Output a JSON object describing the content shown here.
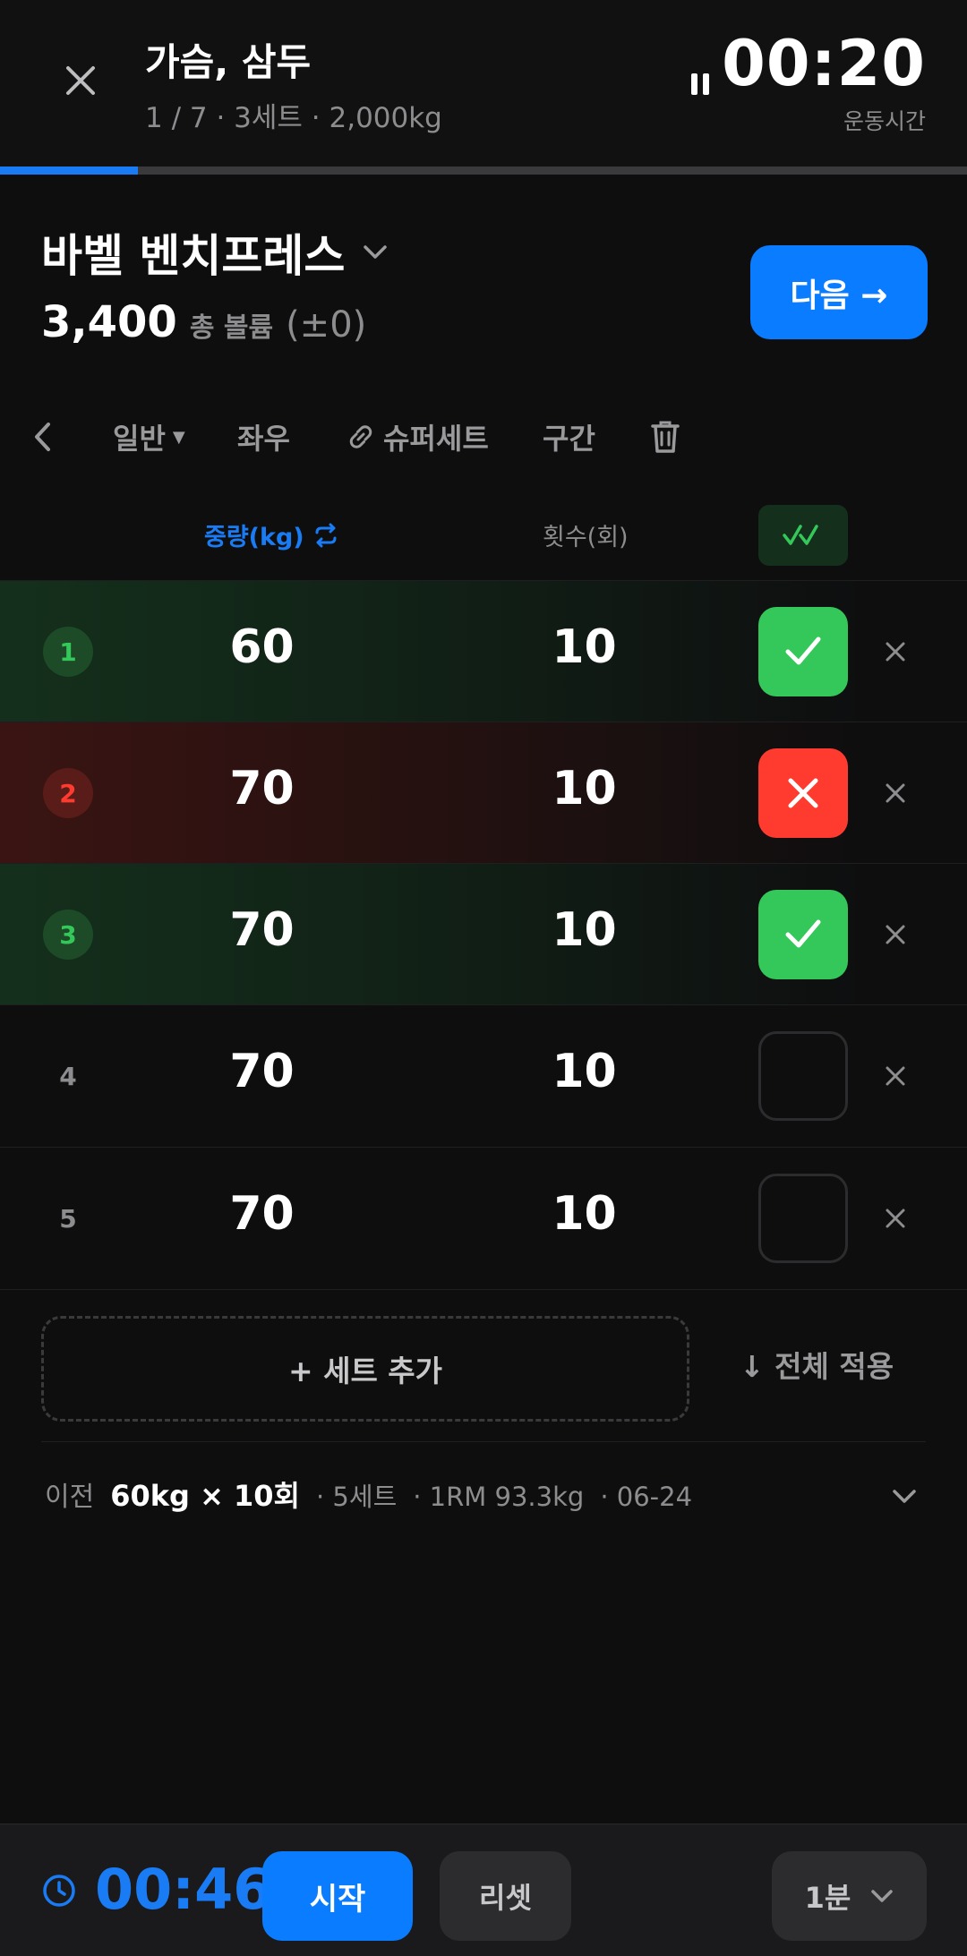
{
  "header": {
    "title": "가슴, 삼두",
    "subtitle": "1 / 7 · 3세트 · 2,000kg",
    "elapsed_time": "00:20",
    "elapsed_label": "운동시간",
    "progress_fraction": 0.143
  },
  "exercise": {
    "name": "바벨 벤치프레스",
    "volume_value": "3,400",
    "volume_label": "총 볼륨",
    "volume_delta": "(±0)",
    "next_label": "다음 →"
  },
  "toolbar": {
    "type_label": "일반",
    "side_label": "좌우",
    "superset_label": "슈퍼세트",
    "interval_label": "구간"
  },
  "columns": {
    "weight": "중량(kg)",
    "reps": "횟수(회)"
  },
  "sets": [
    {
      "num": "1",
      "weight": "60",
      "reps": "10",
      "status": "done"
    },
    {
      "num": "2",
      "weight": "70",
      "reps": "10",
      "status": "failed"
    },
    {
      "num": "3",
      "weight": "70",
      "reps": "10",
      "status": "done"
    },
    {
      "num": "4",
      "weight": "70",
      "reps": "10",
      "status": "empty"
    },
    {
      "num": "5",
      "weight": "70",
      "reps": "10",
      "status": "empty"
    }
  ],
  "actions": {
    "add_set": "+ 세트 추가",
    "apply_all": "↓ 전체 적용"
  },
  "previous": {
    "label": "이전",
    "main": "60kg × 10회",
    "sets": "· 5세트",
    "one_rm": "· 1RM 93.3kg",
    "date": "· 06-24"
  },
  "rest": {
    "time": "00:46",
    "start_label": "시작",
    "reset_label": "리셋",
    "duration": "1분"
  },
  "colors": {
    "accent": "#0a7cff",
    "success": "#34c759",
    "danger": "#ff3b30"
  }
}
